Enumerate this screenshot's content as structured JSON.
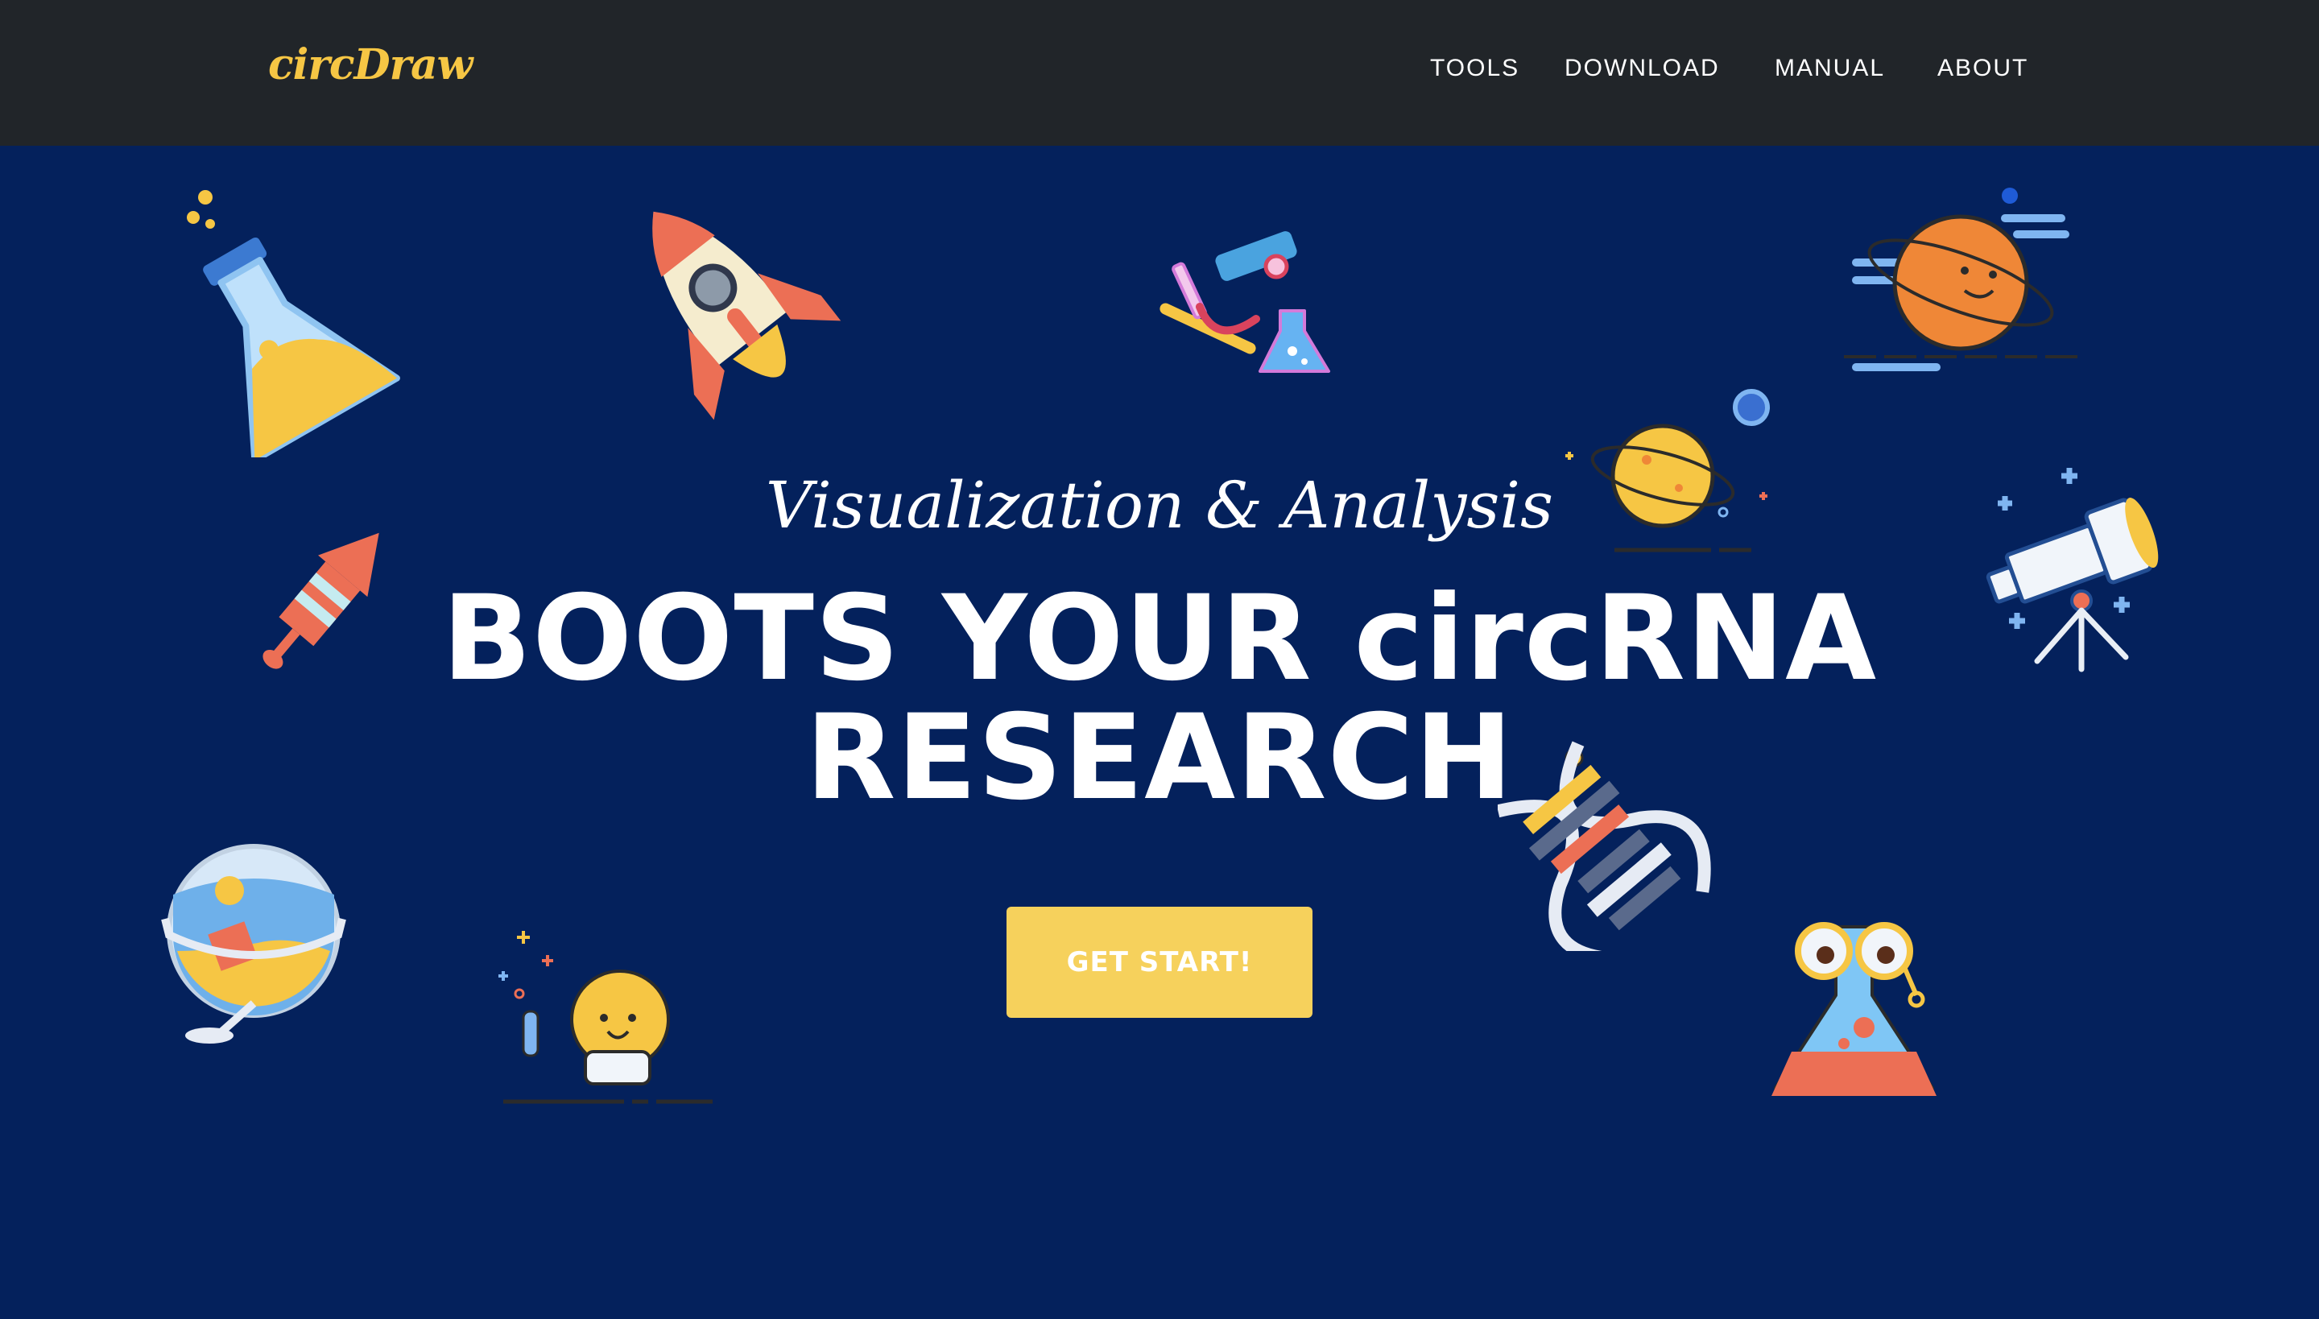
{
  "nav": {
    "brand": "circDraw",
    "links": [
      "TOOLS",
      "DOWNLOAD",
      "MANUAL",
      "ABOUT"
    ]
  },
  "hero": {
    "subheading": "Visualization & Analysis",
    "heading_line1": "BOOTS YOUR circRNA",
    "heading_line2": "RESEARCH",
    "cta_label": "GET START!"
  },
  "icons": [
    "flask-icon",
    "rocket-icon",
    "microscope-icon",
    "planet-orange-icon",
    "planet-yellow-icon",
    "firework-rocket-icon",
    "telescope-icon",
    "dna-icon",
    "globe-icon",
    "lightbulb-icon",
    "scientist-flask-icon"
  ],
  "colors": {
    "navbar_bg": "#212529",
    "hero_bg": "#04215c",
    "brand": "#f6c644",
    "button": "#f6d15c",
    "text": "#ffffff"
  }
}
